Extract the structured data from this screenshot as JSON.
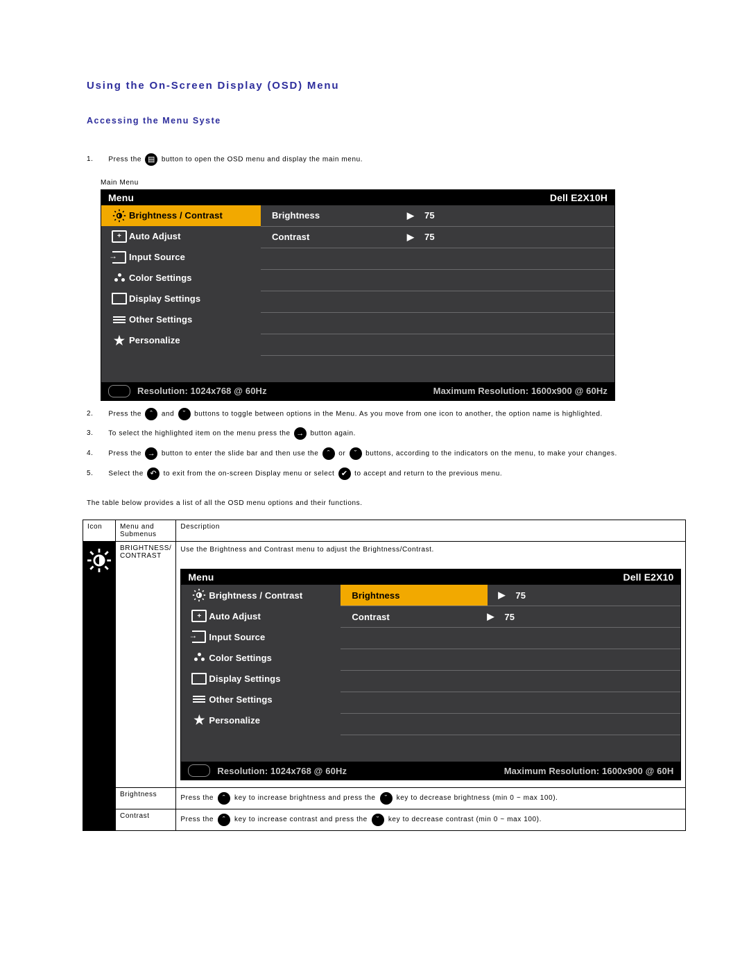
{
  "headings": {
    "h1": "Using the On-Screen Display (OSD) Menu",
    "h2": "Accessing the Menu Syste"
  },
  "steps": {
    "s1a": "Press the",
    "s1b": "button to open the OSD menu and display the main menu.",
    "s2a": "Press the",
    "s2b": "and",
    "s2c": "buttons to toggle between options in the Menu. As you move from one icon to another, the option name is highlighted.",
    "s3a": "To select the highlighted item on the menu press the",
    "s3b": "button again.",
    "s4a": "Press the",
    "s4b": "button to enter the slide bar and then use the",
    "s4c": "or",
    "s4d": "buttons, according to the indicators on the menu, to make your changes.",
    "s5a": "Select the",
    "s5b": "to exit from the on-screen Display menu or select",
    "s5c": "to accept and return to the previous menu."
  },
  "caption_main": "Main Menu",
  "para": "The table below provides a list of all the OSD menu options and their functions.",
  "osd": {
    "menu_title": "Menu",
    "model": "Dell E2X10H",
    "model_short": "Dell E2X10",
    "nav": {
      "brightness": "Brightness / Contrast",
      "auto": "Auto Adjust",
      "input": "Input Source",
      "color": "Color Settings",
      "display": "Display Settings",
      "other": "Other Settings",
      "personal": "Personalize"
    },
    "sub": {
      "brightness": "Brightness",
      "contrast": "Contrast",
      "val1": "75",
      "val2": "75",
      "arrow": "▶"
    },
    "foot": {
      "res": "Resolution: 1024x768 @ 60Hz",
      "max": "Maximum Resolution: 1600x900 @ 60Hz",
      "max_cut": "Maximum Resolution: 1600x900 @ 60H"
    }
  },
  "table": {
    "h_icon": "Icon",
    "h_menu": "Menu and Submenus",
    "h_desc": "Description",
    "r1_menu": "BRIGHTNESS/ CONTRAST",
    "r1_desc": "Use the Brightness and Contrast menu to adjust the Brightness/Contrast.",
    "r2_menu": "Brightness",
    "r2a": "Press the",
    "r2b": "key to increase brightness and press the",
    "r2c": "key to decrease brightness (min 0 ~ max 100).",
    "r3_menu": "Contrast",
    "r3a": "Press the",
    "r3b": "key to increase contrast and press the",
    "r3c": "key to decrease contrast (min 0 ~ max 100)."
  },
  "glyphs": {
    "menu": "▤",
    "up": "ˆ",
    "down": "ˇ",
    "right": "→",
    "back": "↶",
    "check": "✔",
    "plus": "+",
    "star": "★"
  }
}
